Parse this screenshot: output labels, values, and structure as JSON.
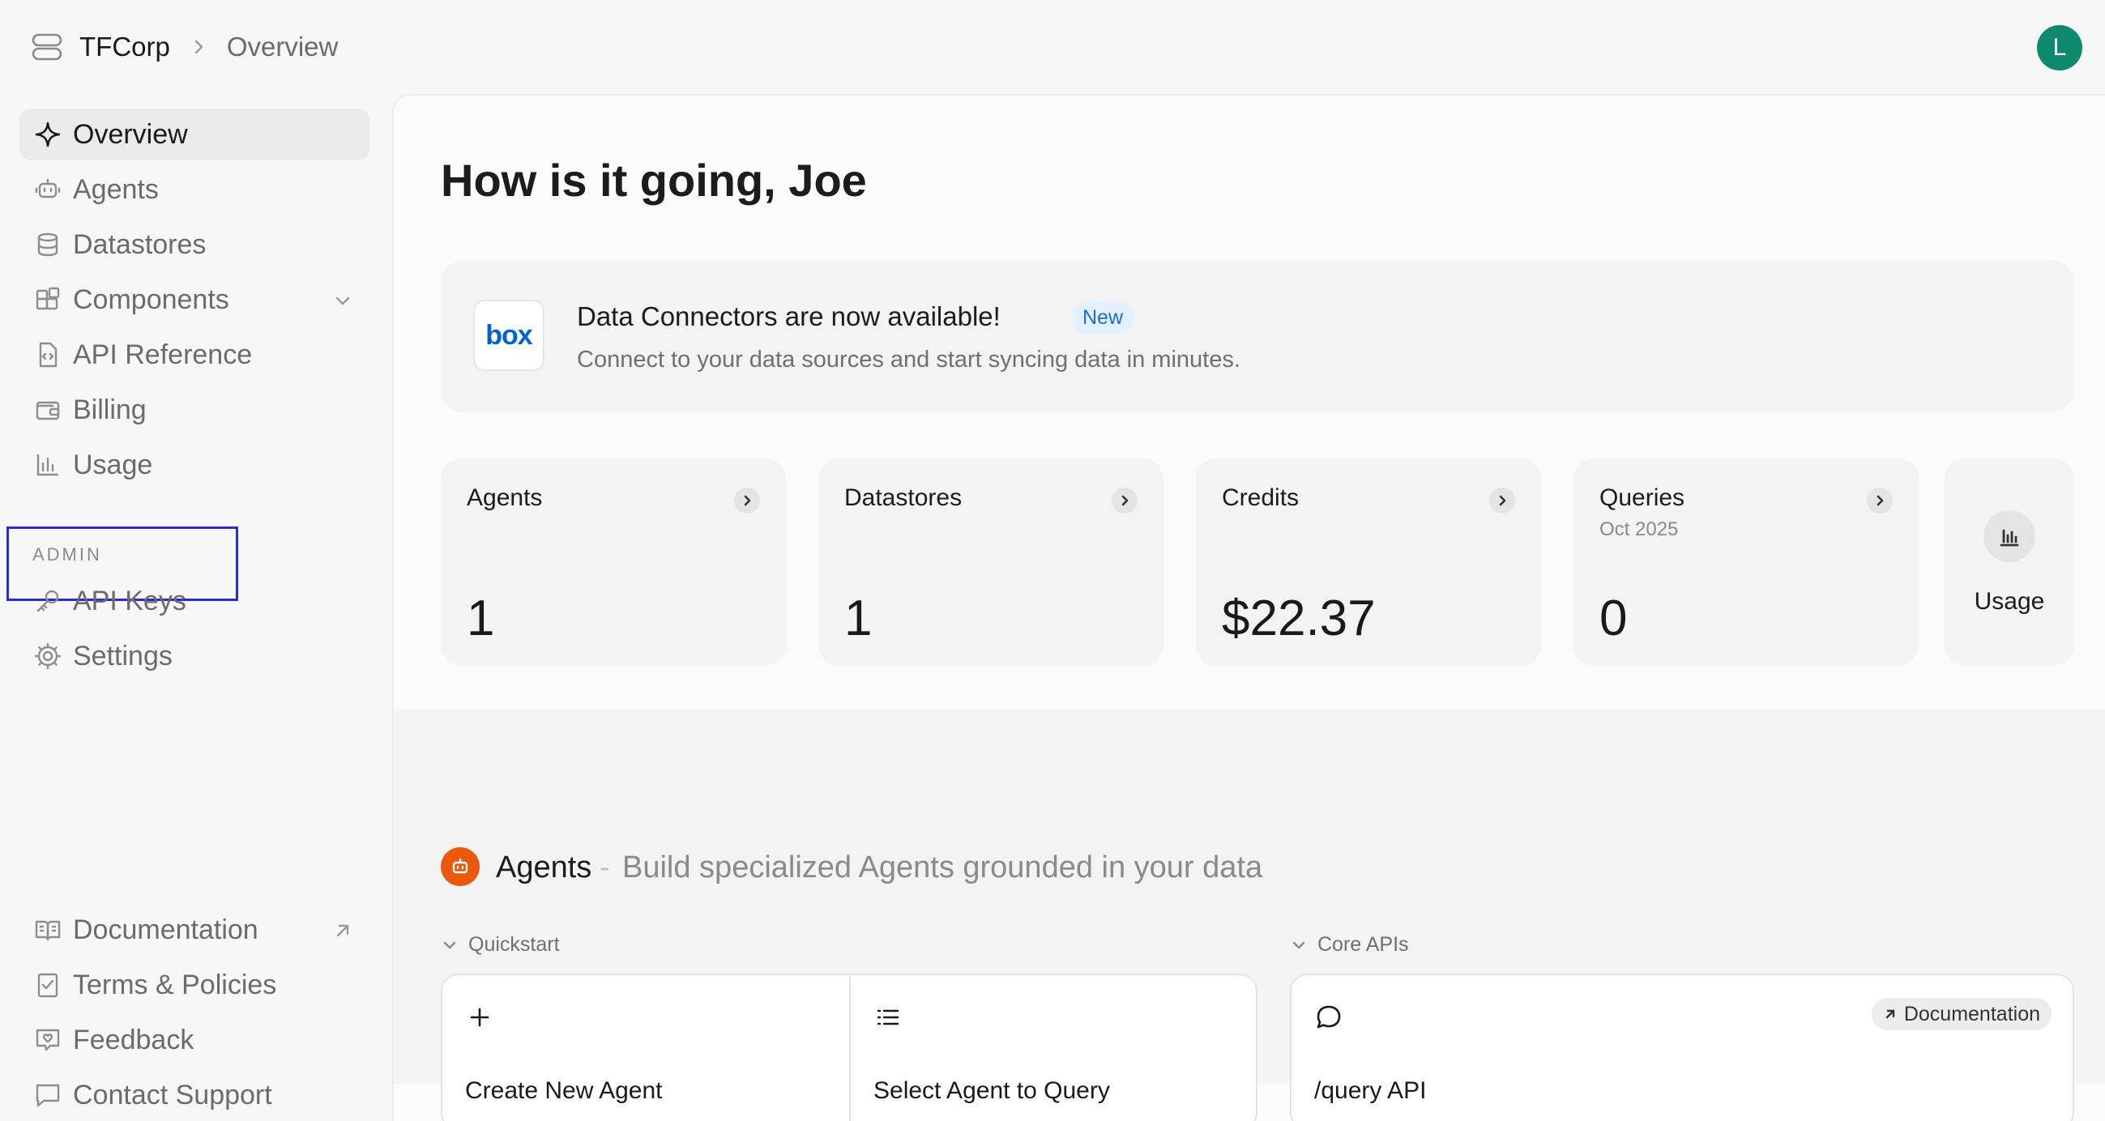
{
  "header": {
    "org_name": "TFCorp",
    "current_page": "Overview",
    "avatar_initial": "L"
  },
  "sidebar": {
    "items": [
      {
        "label": "Overview",
        "icon": "sparkle-icon",
        "active": true
      },
      {
        "label": "Agents",
        "icon": "robot-icon"
      },
      {
        "label": "Datastores",
        "icon": "database-icon"
      },
      {
        "label": "Components",
        "icon": "components-icon"
      },
      {
        "label": "API Reference",
        "icon": "code-file-icon"
      },
      {
        "label": "Billing",
        "icon": "wallet-icon"
      },
      {
        "label": "Usage",
        "icon": "bar-chart-icon"
      }
    ],
    "admin_label": "ADMIN",
    "admin_items": [
      {
        "label": "API Keys",
        "icon": "key-icon"
      },
      {
        "label": "Settings",
        "icon": "gear-icon"
      }
    ],
    "footer_items": [
      {
        "label": "Documentation",
        "icon": "book-icon"
      },
      {
        "label": "Terms & Policies",
        "icon": "checklist-icon"
      },
      {
        "label": "Feedback",
        "icon": "feedback-icon"
      },
      {
        "label": "Contact Support",
        "icon": "chat-icon"
      }
    ]
  },
  "main": {
    "greeting": "How is it going, Joe",
    "banner": {
      "logo_text": "box",
      "title": "Data Connectors are now available!",
      "badge": "New",
      "subtitle": "Connect to your data sources and start syncing data in minutes."
    },
    "stats": [
      {
        "label": "Agents",
        "sub": "",
        "value": "1"
      },
      {
        "label": "Datastores",
        "sub": "",
        "value": "1"
      },
      {
        "label": "Credits",
        "sub": "",
        "value": "$22.37"
      },
      {
        "label": "Queries",
        "sub": "Oct 2025",
        "value": "0"
      }
    ],
    "usage_card_label": "Usage",
    "agents_section": {
      "title": "Agents",
      "separator": "-",
      "description": "Build specialized Agents grounded in your data",
      "quickstart_label": "Quickstart",
      "core_apis_label": "Core APIs",
      "actions": [
        {
          "label": "Create New Agent",
          "icon": "plus-icon"
        },
        {
          "label": "Select Agent to Query",
          "icon": "list-icon"
        }
      ],
      "core_api": {
        "label": "/query API",
        "icon": "speech-bubble-icon",
        "doc_label": "Documentation"
      }
    }
  },
  "colors": {
    "avatar": "#0d8a6e",
    "agents_accent": "#ea580c",
    "badge_bg": "#e3f0ff",
    "badge_text": "#1b6fd1",
    "highlight_box": "#2b2bd6",
    "box_brand": "#0061d5"
  }
}
